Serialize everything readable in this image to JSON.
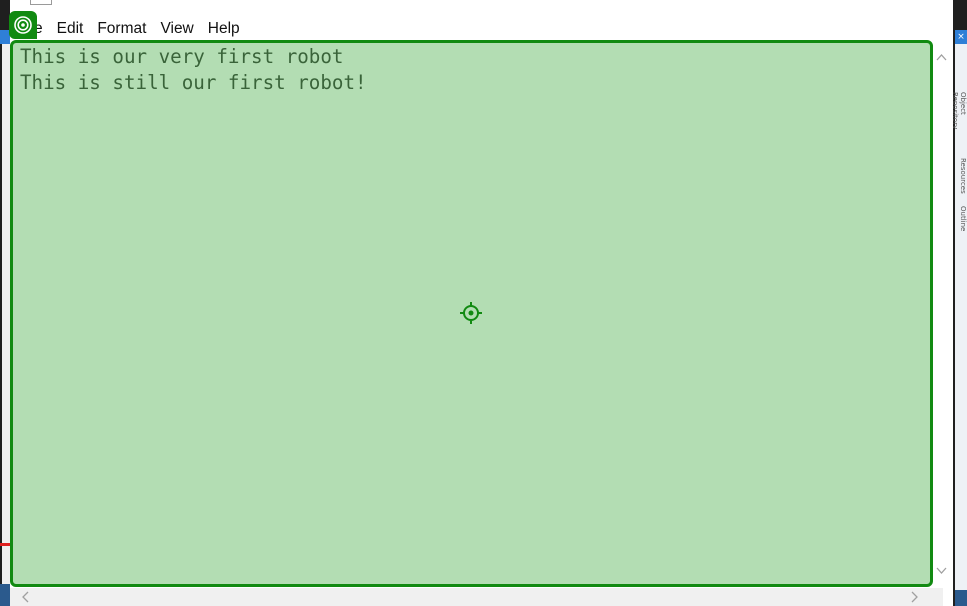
{
  "menu": {
    "file_label": "e",
    "edit_label": "Edit",
    "format_label": "Format",
    "view_label": "View",
    "help_label": "Help"
  },
  "editor": {
    "lines": [
      "This is our very first robot",
      "This is still our first robot!"
    ]
  },
  "highlight": {
    "color": "#118a11",
    "fill_color": "rgba(110,190,110,0.52)",
    "badge_icon": "target-icon",
    "center_icon": "crosshair-icon"
  },
  "right_panel": {
    "labels": [
      "Object Repository",
      "Resources",
      "Outline"
    ]
  },
  "scrollbars": {
    "up_icon": "chevron-up-icon",
    "down_icon": "chevron-down-icon",
    "left_icon": "chevron-left-icon",
    "right_icon": "chevron-right-icon"
  }
}
